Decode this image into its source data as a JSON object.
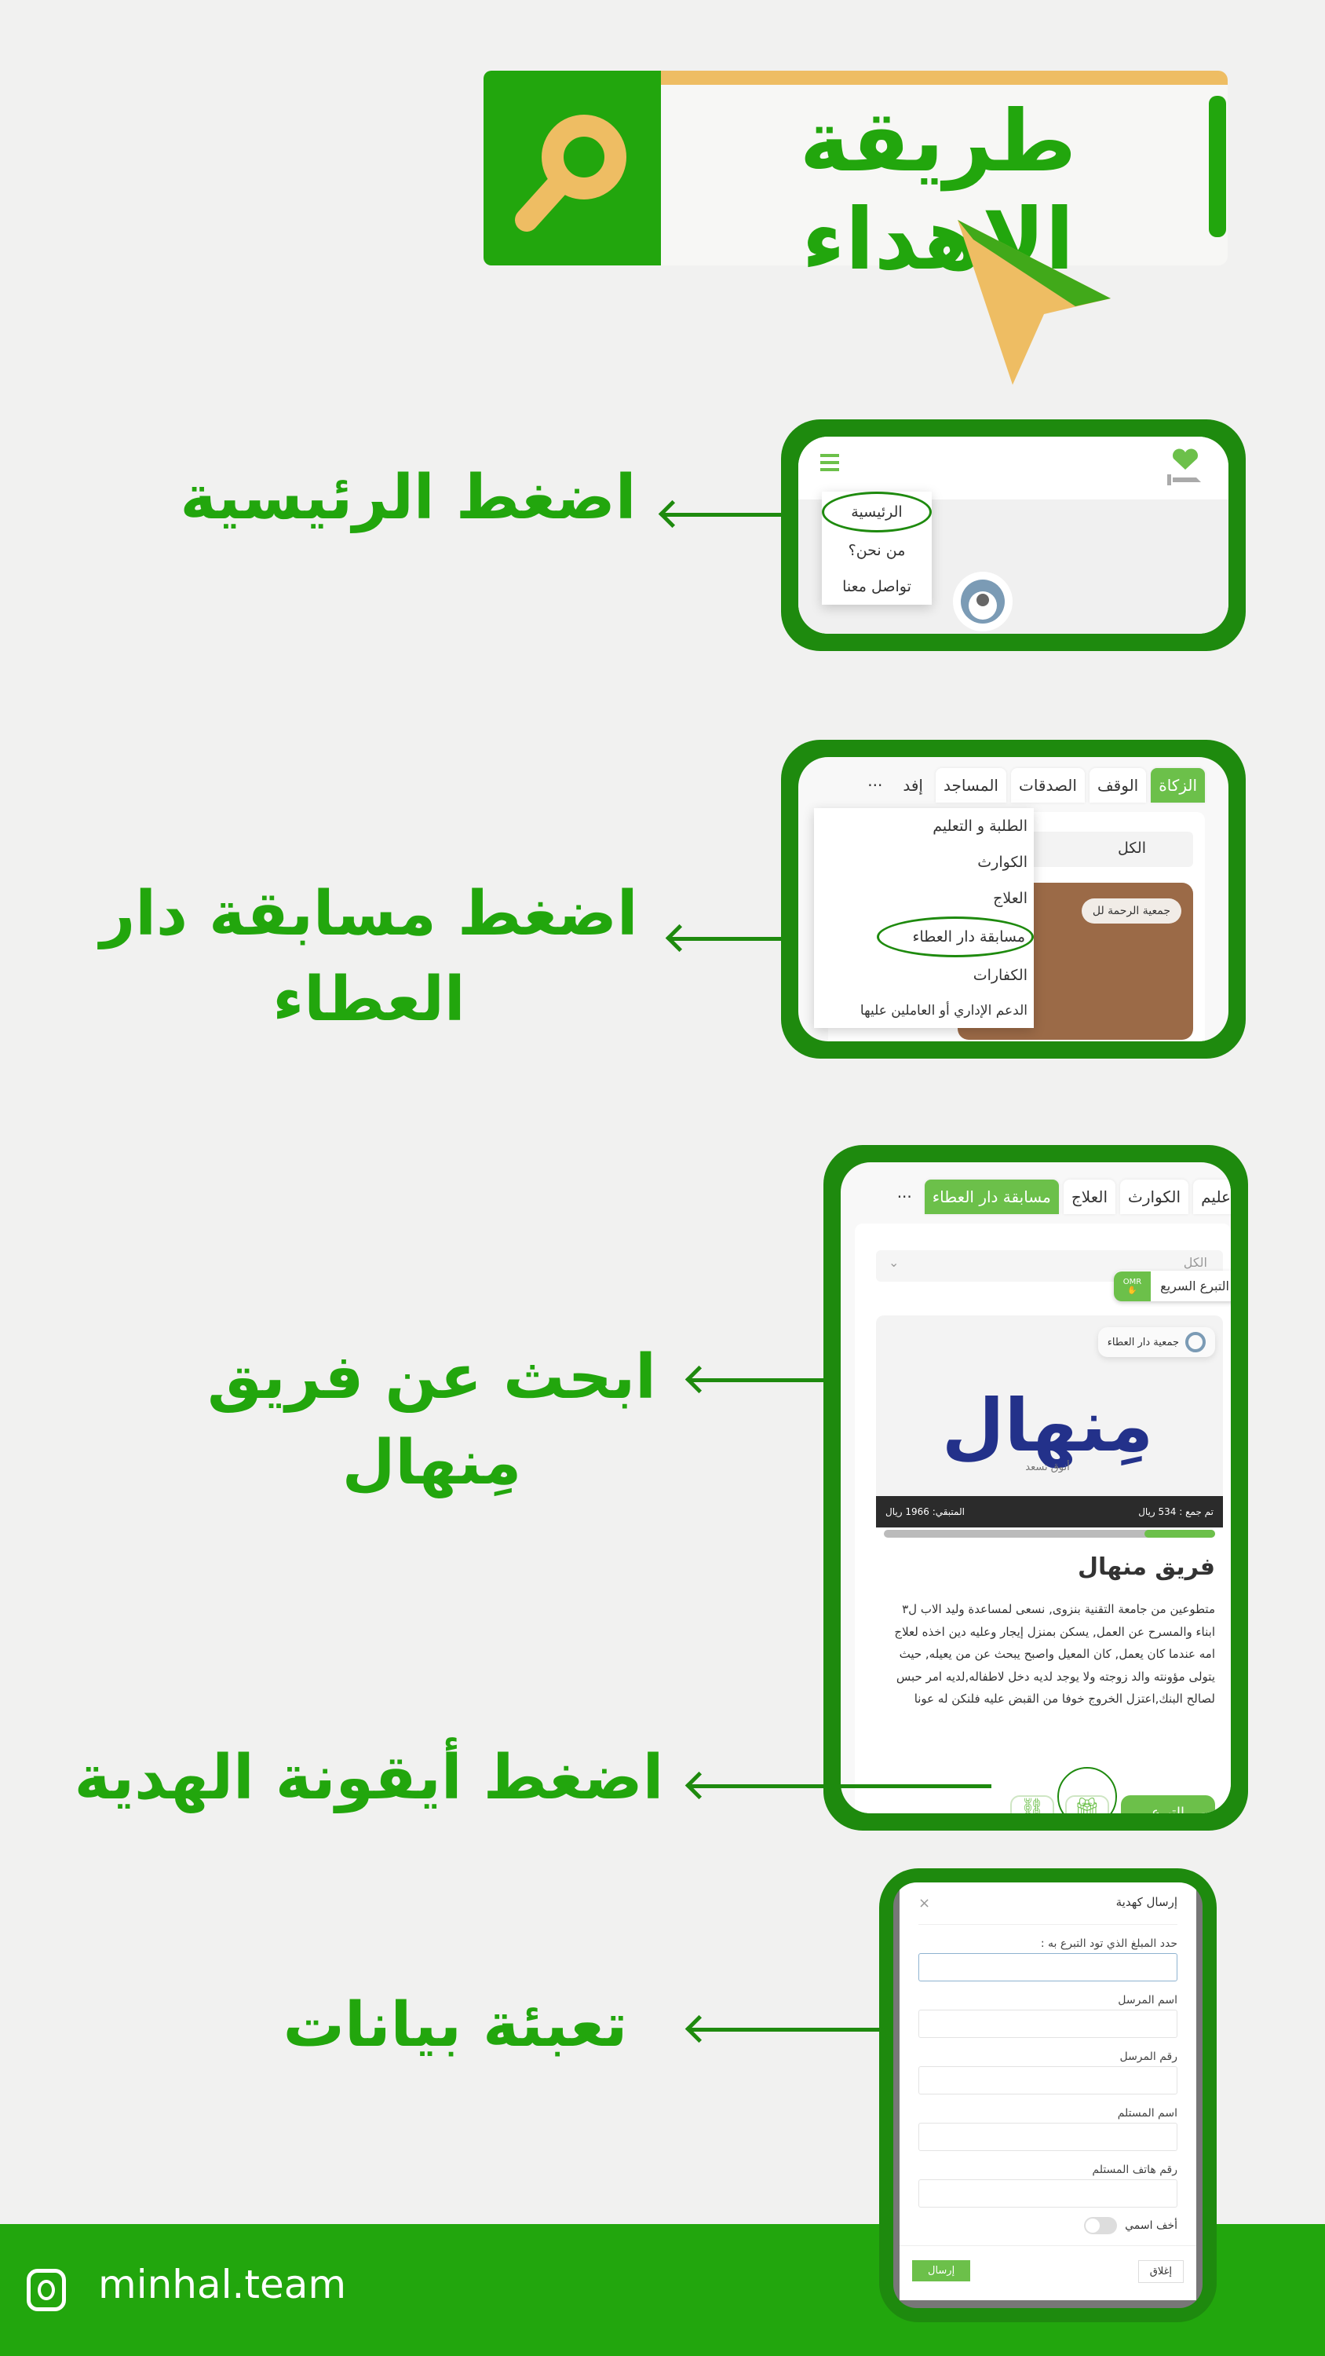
{
  "title": "طريقة الإهداء",
  "colors": {
    "primary_green": "#22a60d",
    "frame_green": "#1e8a0e",
    "accent_gold": "#eebd63",
    "button_green": "#6cc04a"
  },
  "steps": [
    {
      "label": "اضغط الرئيسية"
    },
    {
      "label_line1": "اضغط مسابقة دار",
      "label_line2": "العطاء"
    },
    {
      "label_line1": "ابحث عن فريق",
      "label_line2": "مِنهال"
    },
    {
      "label": "اضغط أيقونة الهدية"
    },
    {
      "label": "تعبئة بيانات"
    }
  ],
  "screen1": {
    "menu": [
      "الرئيسية",
      "من نحن؟",
      "تواصل معنا"
    ]
  },
  "screen2": {
    "tabs": [
      "الزكاة",
      "الوقف",
      "الصدقات",
      "المساجد",
      "إفد",
      "···"
    ],
    "dropdown": [
      "الطلبة و التعليم",
      "الكوارث",
      "العلاج",
      "مسابقة دار العطاء",
      "الكفارات",
      "الدعم الإداري أو العاملين عليها"
    ],
    "filter": "الكل",
    "card_org": "جمعية الرحمة لل"
  },
  "screen3": {
    "tabs": [
      "عليم",
      "الكوارث",
      "العلاج",
      "مسابقة دار العطاء",
      "···"
    ],
    "filter": "الكل",
    "quick_donate": "التبرع السريع",
    "currency": "OMR",
    "org": "جمعية دار العطاء",
    "logo_text": "مِنهال",
    "logo_tagline": "أنوق تسعد",
    "collected": "تم جمع : 534 ريال",
    "remaining": "المتبقي: 1966 ريال",
    "progress_percent": 21.4,
    "card_title": "فريق منهال",
    "description": "متطوعين من جامعة التقنية بنزوى, نسعى لمساعدة وليد الاب ل٣ ابناء والمسرح عن العمل, يسكن بمنزل إيجار وعليه دين اخذه لعلاج امه عندما كان يعمل, كان المعيل واصبح يبحث عن من يعيله, حيث يتولى مؤونته والد زوجته ولا يوجد لديه دخل لاطفاله,لديه امر حبس لصالح البنك,اعتزل الخروج خوفا من القبض عليه فلنكن له عونا",
    "donate_button": "التبرع"
  },
  "screen5": {
    "modal_title": "إرسال كهدية",
    "close": "×",
    "fields": [
      "حدد المبلغ الذي تود التبرع به :",
      "اسم المرسل",
      "رقم المرسل",
      "اسم المستلم",
      "رقم هاتف المستلم"
    ],
    "hide_name": "أخف اسمي",
    "close_button": "إغلاق",
    "send_button": "إرسال"
  },
  "footer": {
    "handle": "minhal.team"
  }
}
